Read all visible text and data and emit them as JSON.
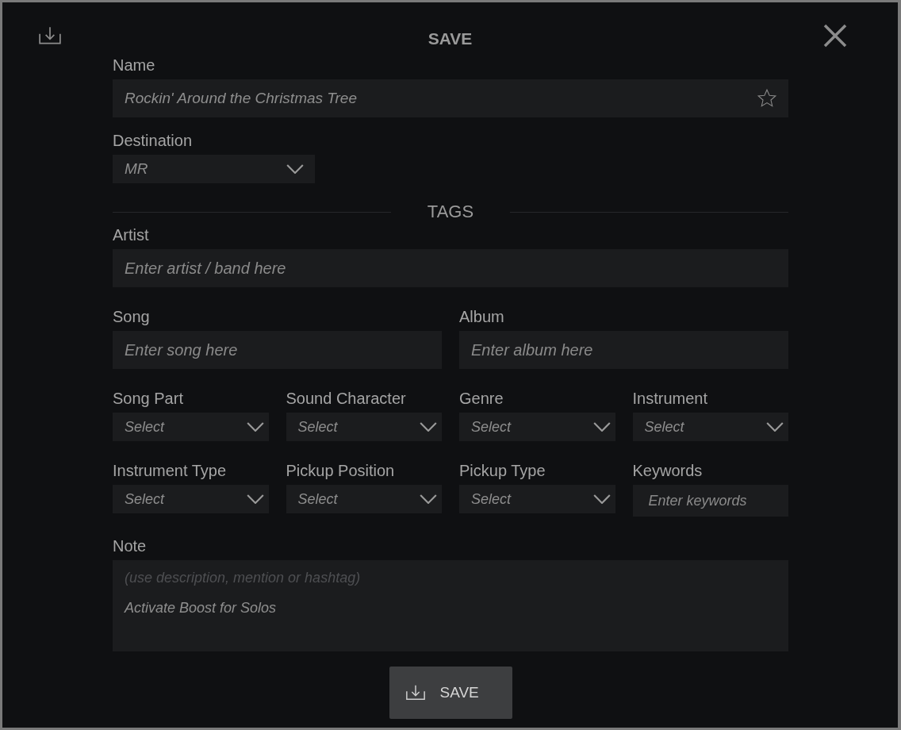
{
  "dialog": {
    "title": "SAVE"
  },
  "name": {
    "label": "Name",
    "value": "Rockin' Around the Christmas Tree",
    "favorite": false
  },
  "destination": {
    "label": "Destination",
    "value": "MR"
  },
  "tags": {
    "heading": "TAGS",
    "artist": {
      "label": "Artist",
      "placeholder": "Enter artist / band here"
    },
    "song": {
      "label": "Song",
      "placeholder": "Enter song here"
    },
    "album": {
      "label": "Album",
      "placeholder": "Enter album here"
    },
    "filters": [
      {
        "kind": "select",
        "label": "Song Part",
        "value": "Select"
      },
      {
        "kind": "select",
        "label": "Sound Character",
        "value": "Select"
      },
      {
        "kind": "select",
        "label": "Genre",
        "value": "Select"
      },
      {
        "kind": "select",
        "label": "Instrument",
        "value": "Select"
      },
      {
        "kind": "select",
        "label": "Instrument Type",
        "value": "Select"
      },
      {
        "kind": "select",
        "label": "Pickup Position",
        "value": "Select"
      },
      {
        "kind": "select",
        "label": "Pickup Type",
        "value": "Select"
      },
      {
        "kind": "text",
        "label": "Keywords",
        "placeholder": "Enter keywords"
      }
    ]
  },
  "note": {
    "label": "Note",
    "hint": "(use description, mention or hashtag)",
    "value": "Activate Boost for Solos"
  },
  "save_button": {
    "label": "SAVE"
  }
}
